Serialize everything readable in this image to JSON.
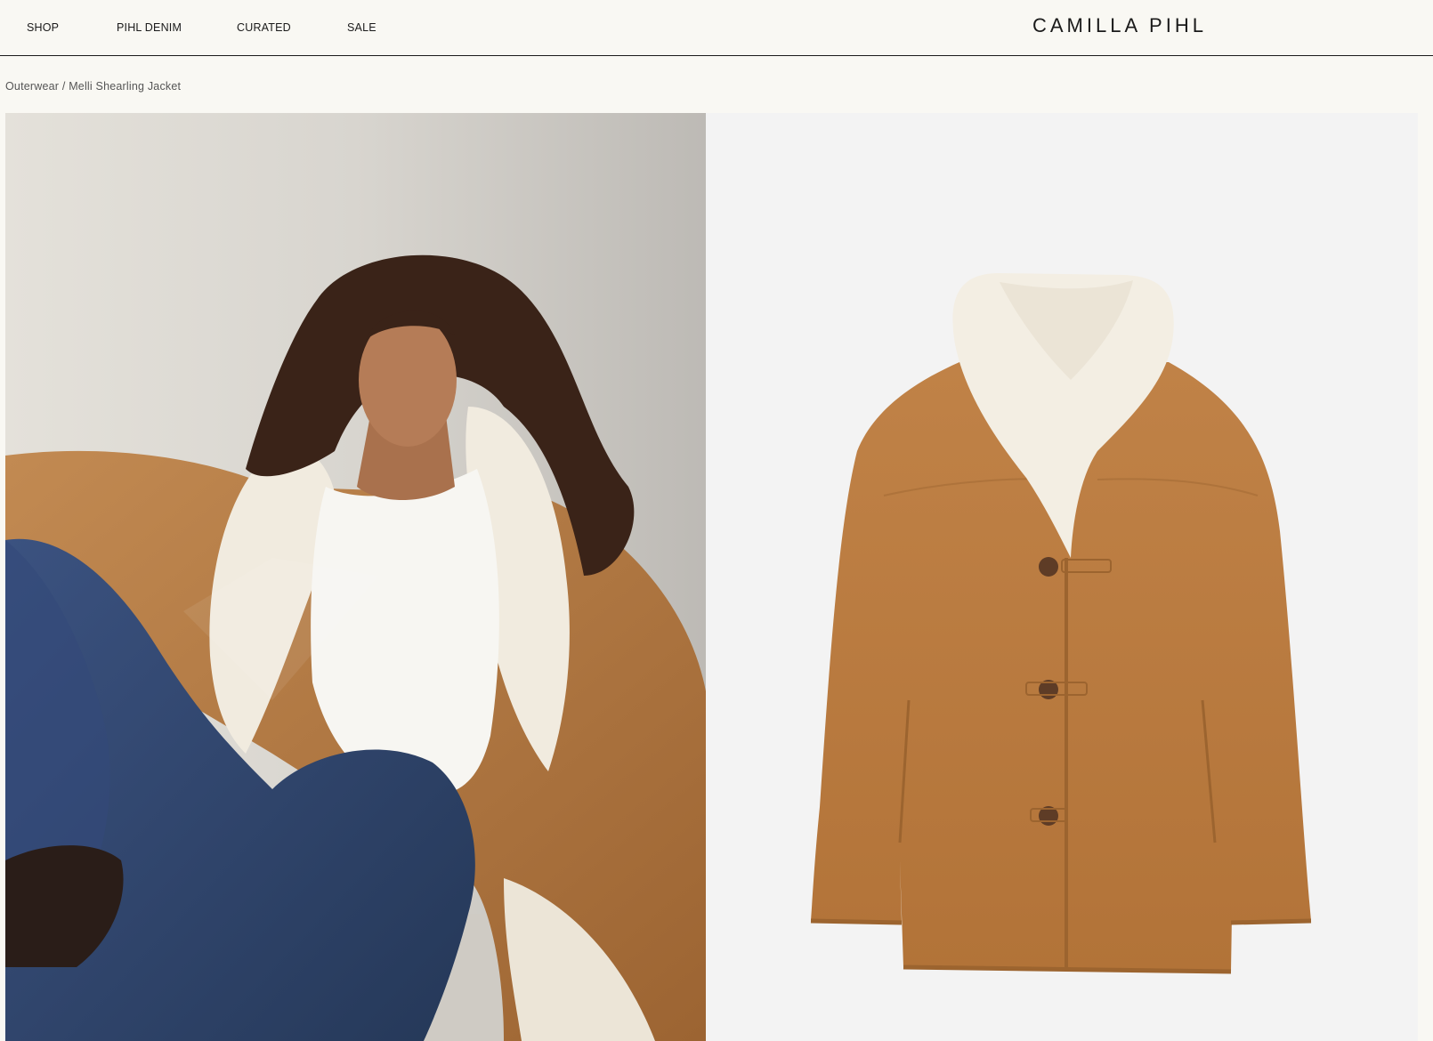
{
  "nav": {
    "items": [
      {
        "label": "SHOP"
      },
      {
        "label": "PIHL DENIM"
      },
      {
        "label": "CURATED"
      },
      {
        "label": "SALE"
      }
    ]
  },
  "brand": {
    "logo": "CAMILLA PIHL"
  },
  "breadcrumb": {
    "category": "Outerwear",
    "separator": " / ",
    "product": "Melli Shearling Jacket"
  },
  "colors": {
    "background": "#f9f8f3",
    "suede": "#b8793f",
    "shearling": "#f2ede2",
    "denim": "#2f4468"
  },
  "images": {
    "model_photo": "model-wearing-jacket-image",
    "product_photo": "jacket-product-image"
  }
}
